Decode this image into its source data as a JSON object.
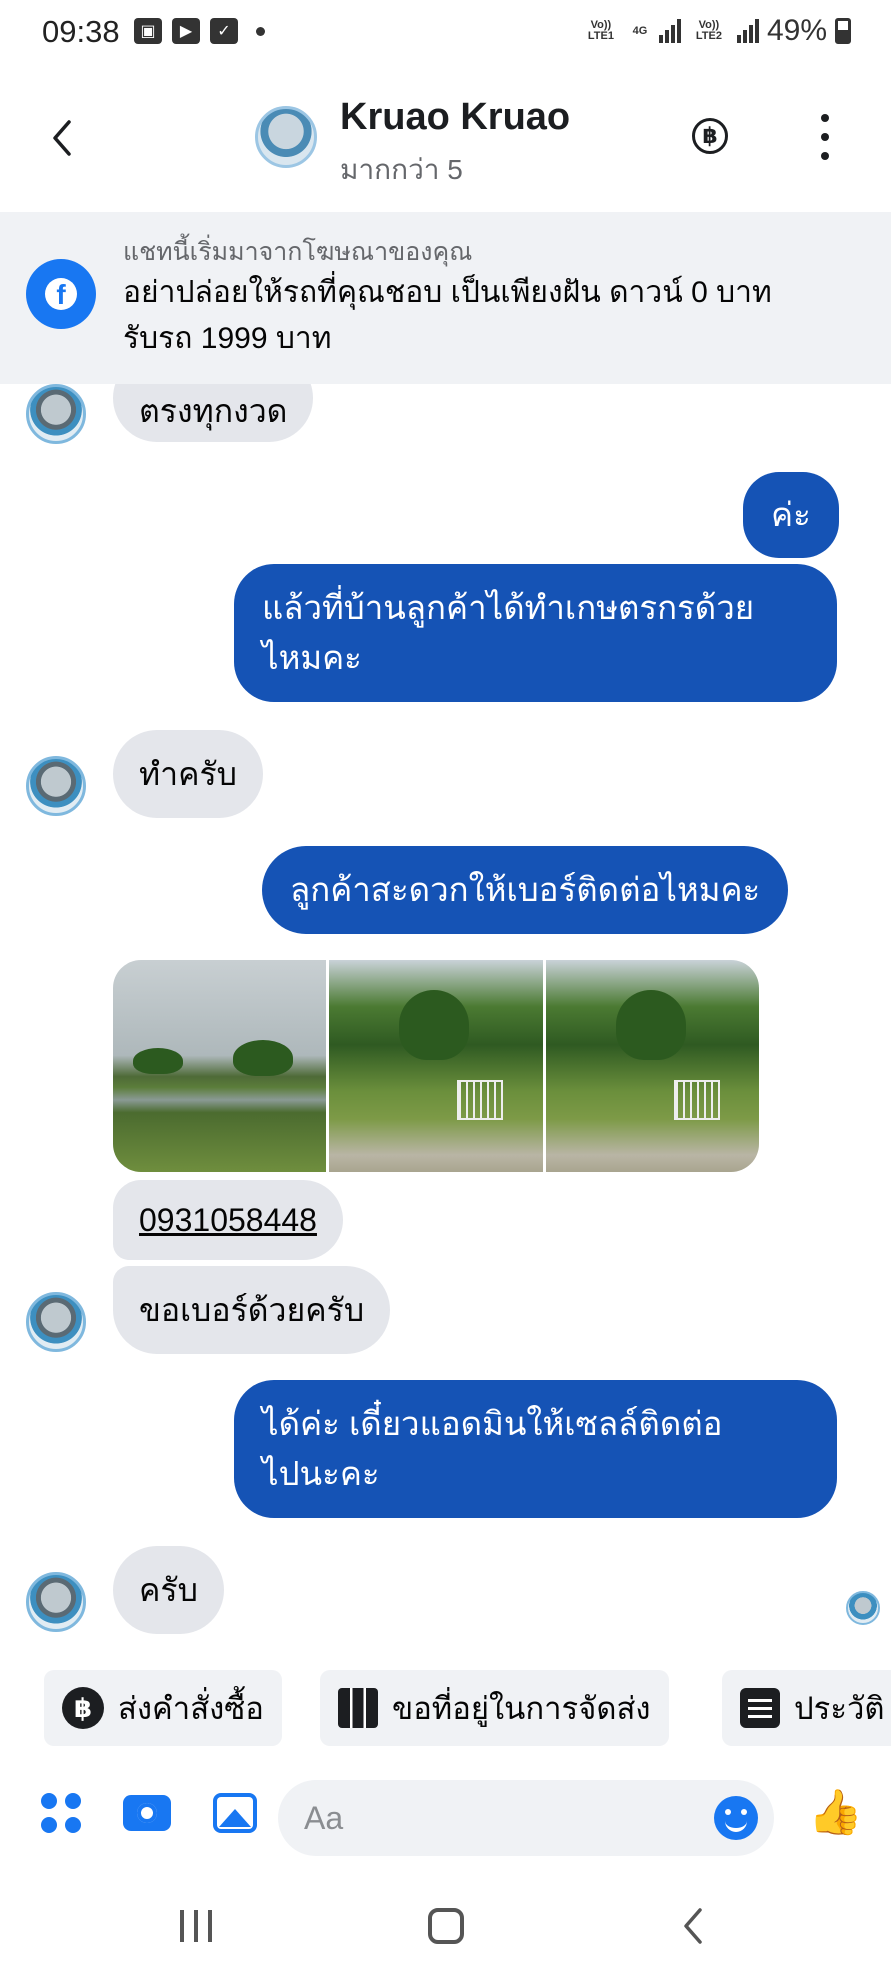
{
  "status_bar": {
    "time": "09:38",
    "sim1_label": "Vo)) LTE1",
    "network": "4G",
    "sim2_label": "Vo)) LTE2",
    "battery": "49%"
  },
  "header": {
    "name": "Kruao Kruao",
    "subtitle": "มากกว่า 5",
    "baht_symbol": "฿",
    "back_icon": "chevron-left-icon",
    "more_icon": "more-vertical-icon"
  },
  "ad_banner": {
    "title": "แชทนี้เริ่มมาจากโฆษณาของคุณ",
    "text_line1": "อย่าปล่อยให้รถที่คุณชอบ เป็นเพียงฝัน ดาวน์ 0 บาท",
    "text_line2": "รับรถ 1999 บาท",
    "icon": "facebook-icon"
  },
  "messages": {
    "m1": "ตรงทุกงวด",
    "m2": "ค่ะ",
    "m3_line1": "แล้วที่บ้านลูกค้าได้ทำเกษตรกรด้วย",
    "m3_line2": "ไหมคะ",
    "m4": "ทำครับ",
    "m5": "ลูกค้าสะดวกให้เบอร์ติดต่อไหมคะ",
    "m6_phone": "0931058448",
    "m7": "ขอเบอร์ด้วยครับ",
    "m8_line1": "ได้ค่ะ เดี๋ยวแอดมินให้เซลล์ติดต่อ",
    "m8_line2": "ไปนะคะ",
    "m9": "ครับ"
  },
  "quick_replies": {
    "order": "ส่งคำสั่งซื้อ",
    "address": "ขอที่อยู่ในการจัดส่ง",
    "history": "ประวัติ"
  },
  "composer": {
    "placeholder": "Aa"
  },
  "colors": {
    "outgoing_bubble": "#1553b5",
    "incoming_bubble": "#e4e6eb",
    "accent": "#1877f2"
  }
}
